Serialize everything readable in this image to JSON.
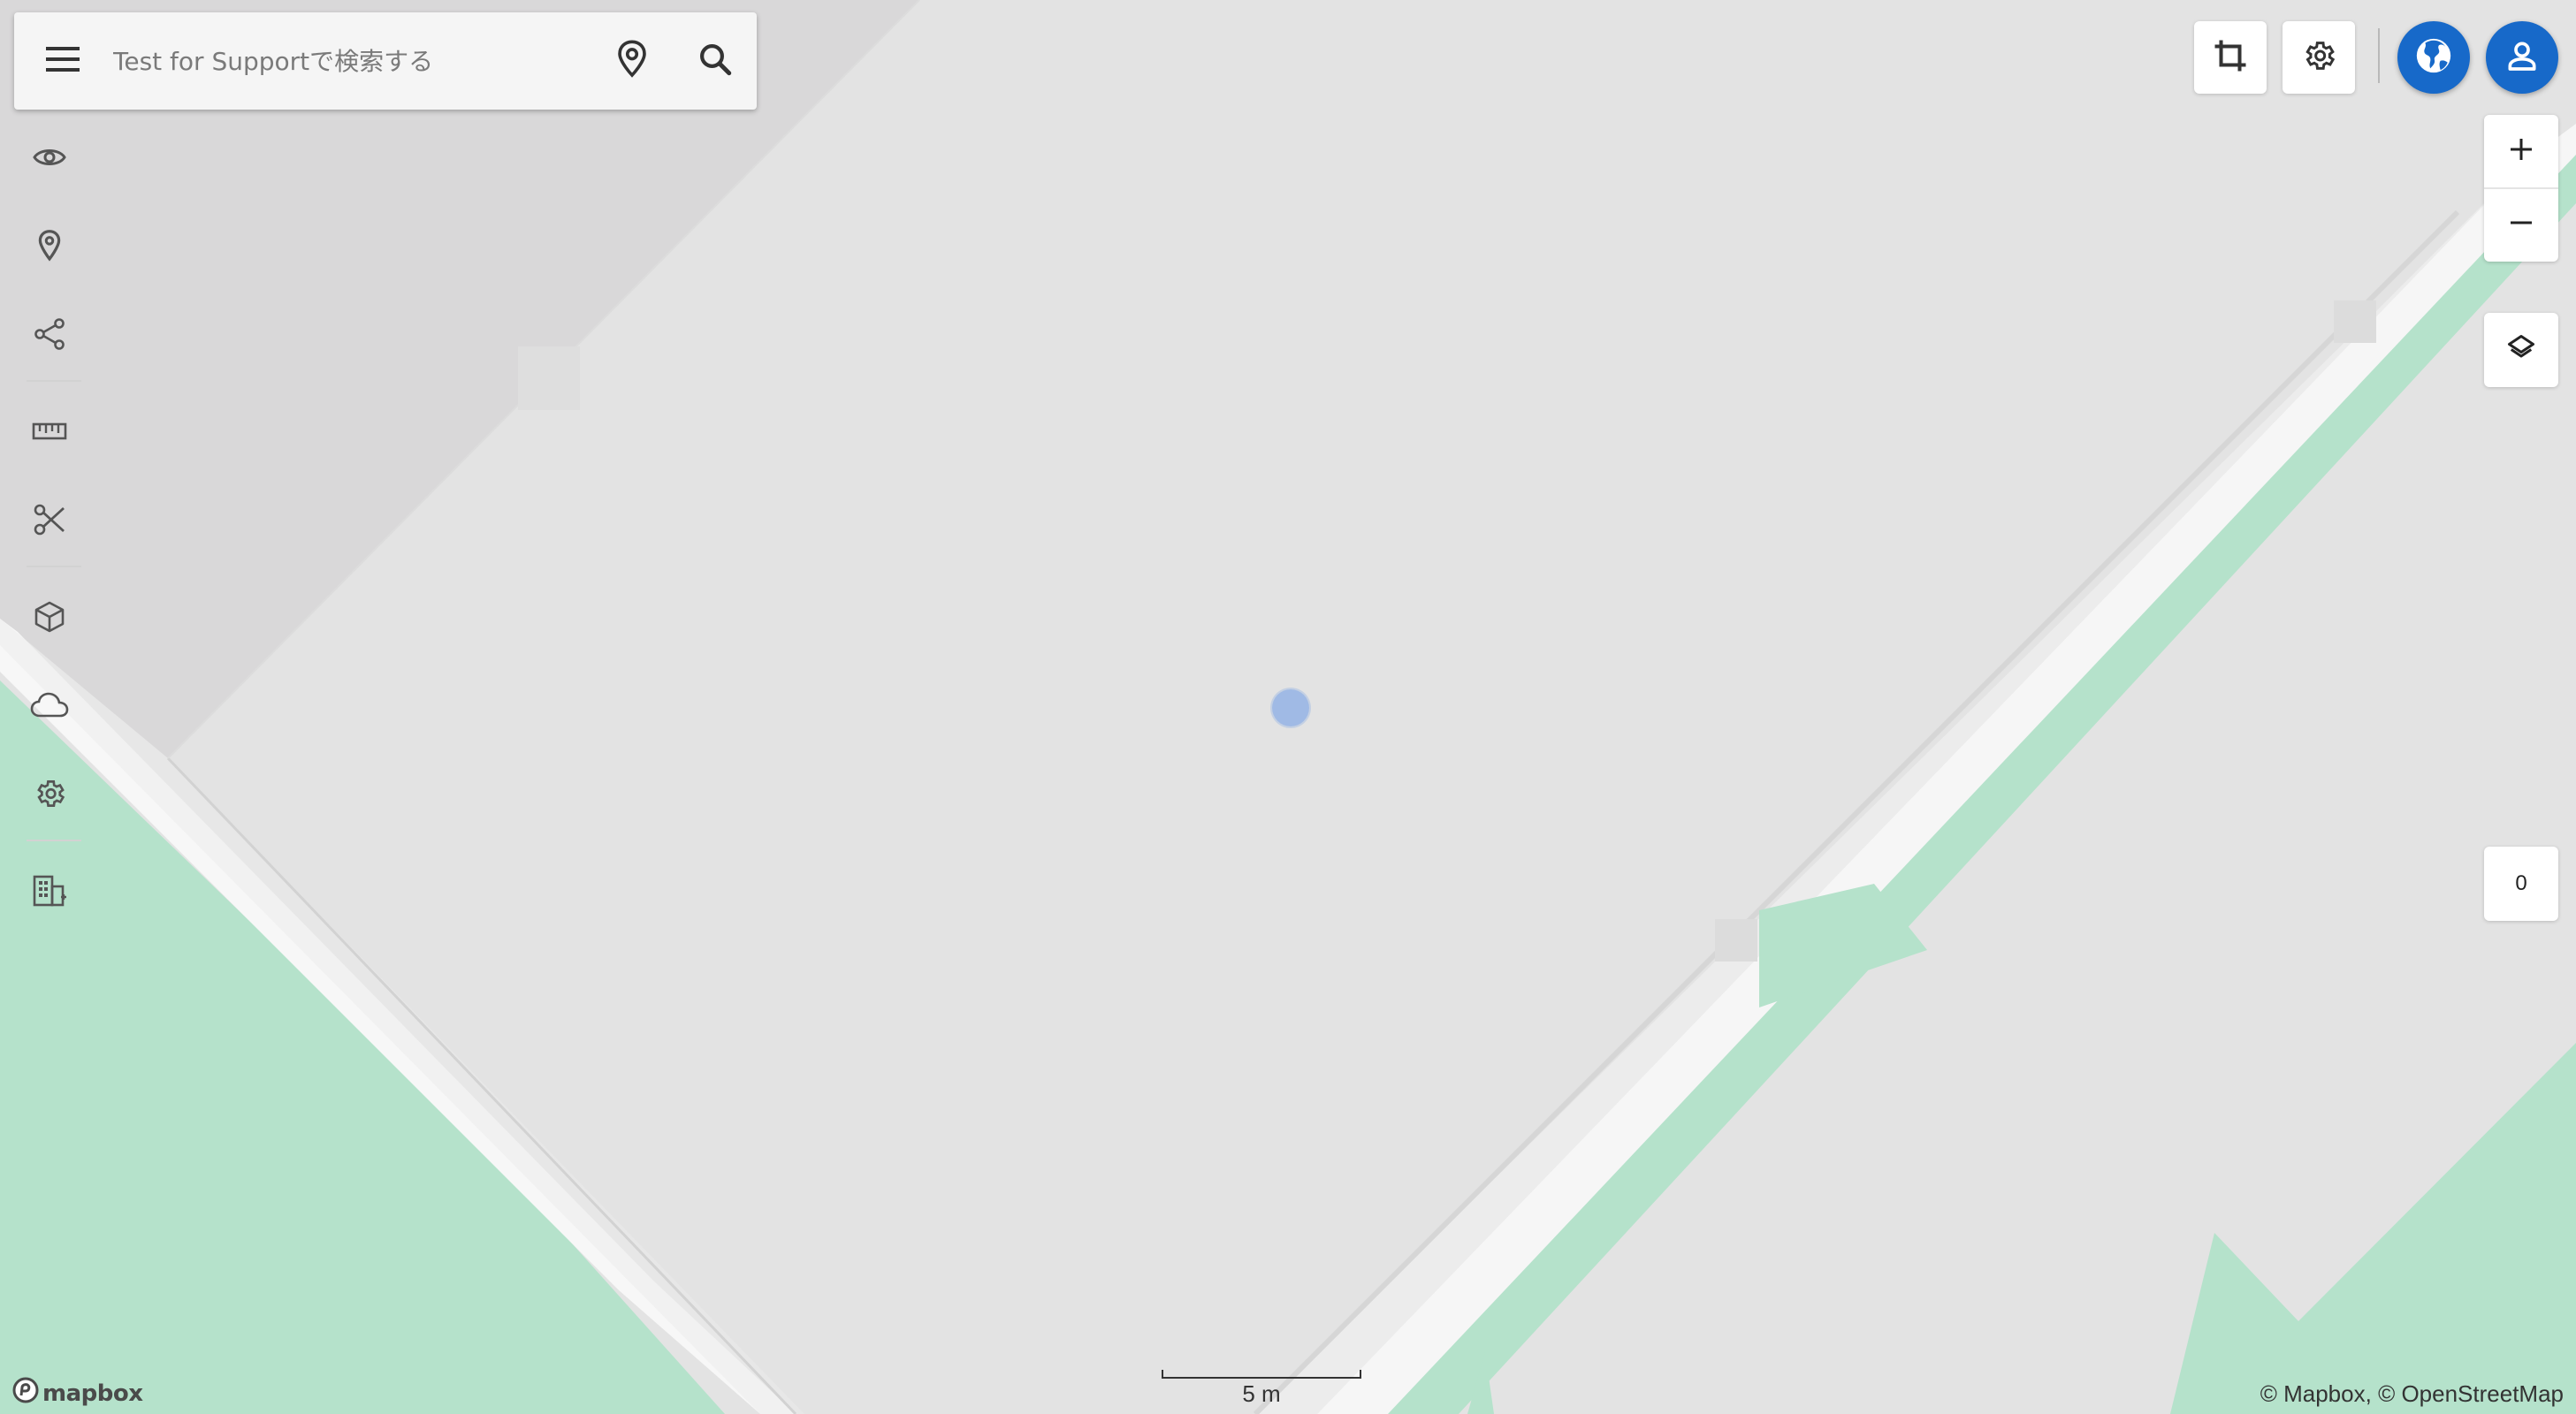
{
  "search": {
    "placeholder": "Test for Supportで検索する"
  },
  "map": {
    "scale_label": "5 m",
    "bearing_value": "0",
    "logo_text": "mapbox",
    "attribution": {
      "mapbox": "© Mapbox,",
      "osm": "© OpenStreetMap"
    }
  },
  "icons": {
    "menu": "hamburger-menu-icon",
    "pin": "location-pin-icon",
    "search": "magnifier-icon",
    "left_tools": [
      "eye-icon",
      "location-pin-icon",
      "share-icon",
      "ruler-icon",
      "scissors-icon",
      "cube-icon",
      "cloud-icon",
      "gear-icon",
      "building-icon"
    ],
    "top_right": [
      "crop-icon",
      "gear-icon",
      "globe-icon",
      "user-icon"
    ],
    "zoom": [
      "plus-icon",
      "minus-icon"
    ],
    "layers": "layers-icon"
  },
  "colors": {
    "map_base": "#e3e3e3",
    "park_green": "#b5e2cb",
    "road_white": "#fafafa",
    "accent_blue": "#1769c9",
    "location_dot": "#7da5e6"
  }
}
